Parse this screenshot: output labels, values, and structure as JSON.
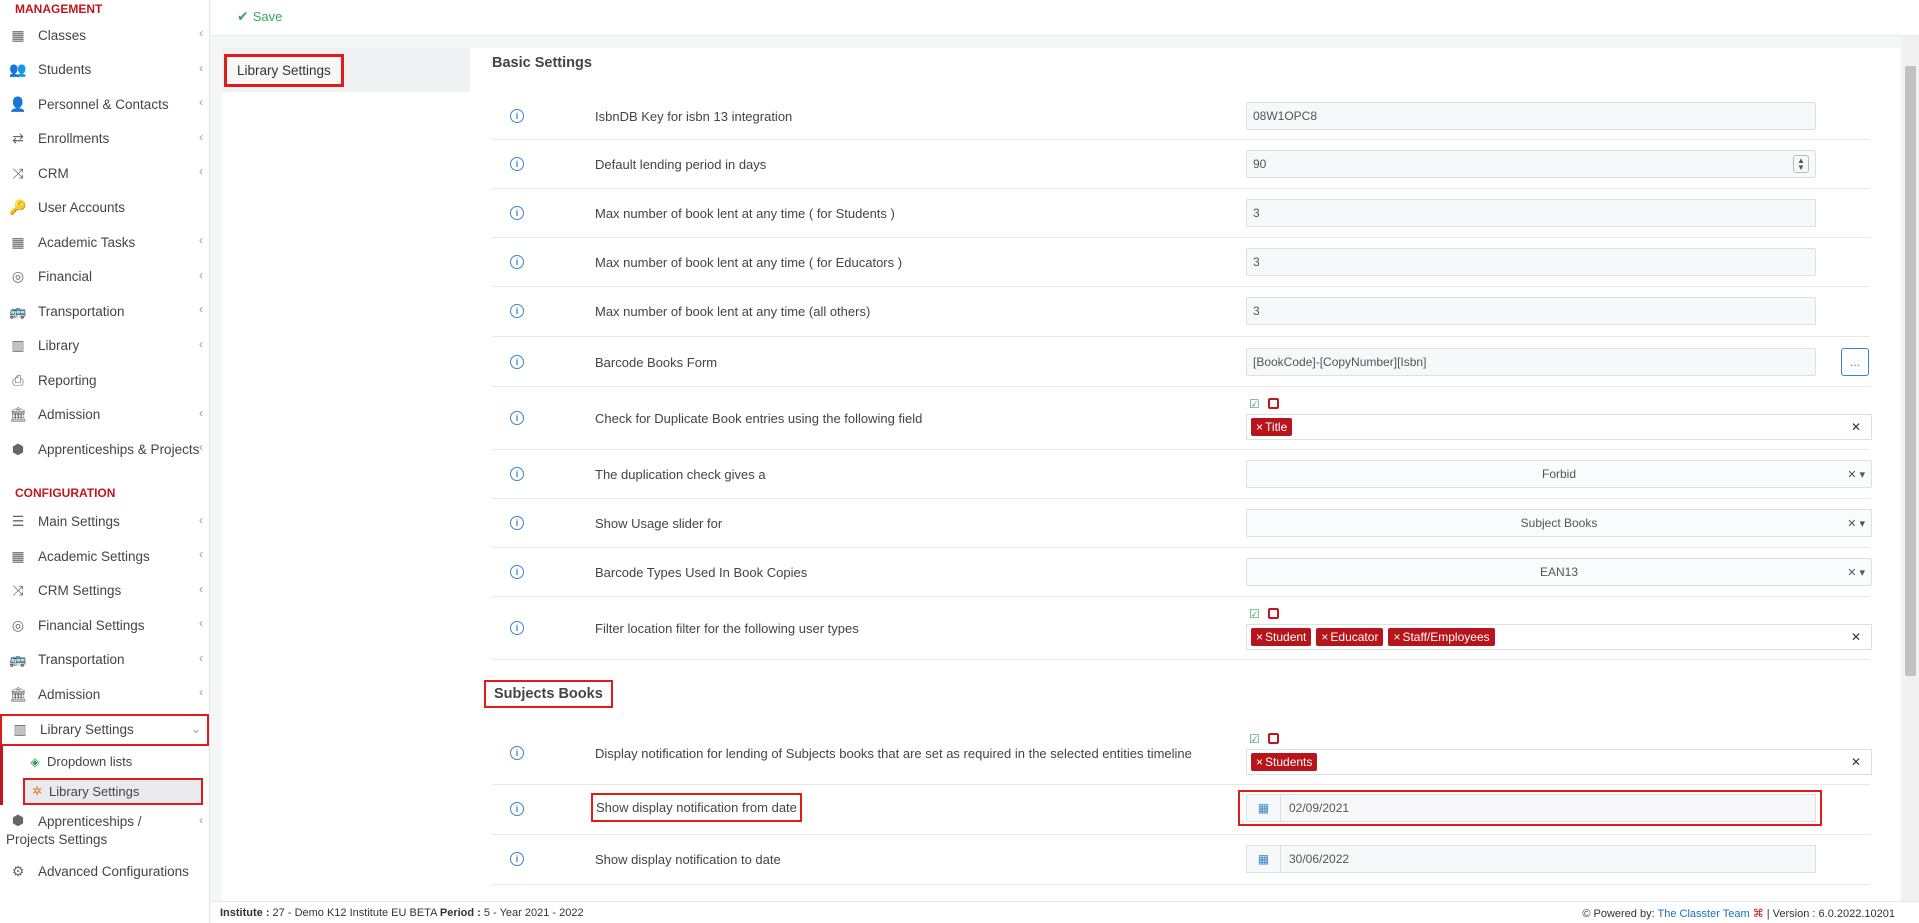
{
  "sidebar": {
    "management_title": "MANAGEMENT",
    "management_items": [
      {
        "label": "Classes",
        "icon": "classes-icon"
      },
      {
        "label": "Students",
        "icon": "students-icon"
      },
      {
        "label": "Personnel & Contacts",
        "icon": "person-icon"
      },
      {
        "label": "Enrollments",
        "icon": "exchange-icon"
      },
      {
        "label": "CRM",
        "icon": "shuffle-icon"
      },
      {
        "label": "User Accounts",
        "icon": "key-icon"
      },
      {
        "label": "Academic Tasks",
        "icon": "tasks-icon"
      },
      {
        "label": "Financial",
        "icon": "coins-icon"
      },
      {
        "label": "Transportation",
        "icon": "bus-icon"
      },
      {
        "label": "Library",
        "icon": "books-icon"
      },
      {
        "label": "Reporting",
        "icon": "printer-icon"
      },
      {
        "label": "Admission",
        "icon": "institution-icon"
      },
      {
        "label": "Apprenticeships & Projects",
        "icon": "cube-icon"
      }
    ],
    "configuration_title": "CONFIGURATION",
    "configuration_items": [
      {
        "label": "Main Settings",
        "icon": "sliders-icon"
      },
      {
        "label": "Academic Settings",
        "icon": "classes-icon"
      },
      {
        "label": "CRM Settings",
        "icon": "shuffle-icon"
      },
      {
        "label": "Financial Settings",
        "icon": "coins-icon"
      },
      {
        "label": "Transportation",
        "icon": "bus-icon"
      },
      {
        "label": "Admission",
        "icon": "institution-icon"
      }
    ],
    "active_item": "Library Settings",
    "sub_items": [
      {
        "label": "Dropdown lists",
        "icon": "layers-icon"
      },
      {
        "label": "Library Settings",
        "icon": "cog-icon"
      }
    ],
    "after_items": [
      {
        "label": "Apprenticeships / Projects Settings",
        "icon": "cube-icon"
      },
      {
        "label": "Advanced Configurations",
        "icon": "cogs-icon"
      }
    ]
  },
  "toolbar": {
    "save_label": "Save"
  },
  "tabs": [
    {
      "label": "Library Settings"
    }
  ],
  "basic": {
    "title": "Basic Settings",
    "isbndb_label": "IsbnDB Key for isbn 13 integration",
    "isbndb_value": "08W1OPC8",
    "lending_label": "Default lending period in days",
    "lending_value": "90",
    "max_students_label": "Max number of book lent at any time ( for Students )",
    "max_students_value": "3",
    "max_educators_label": "Max number of book lent at any time ( for Educators )",
    "max_educators_value": "3",
    "max_others_label": "Max number of book lent at any time (all others)",
    "max_others_value": "3",
    "barcode_form_label": "Barcode Books Form",
    "barcode_form_value": "[BookCode]-[CopyNumber][Isbn]",
    "barcode_form_btn": "...",
    "duplicate_label": "Check for Duplicate Book entries using the following field",
    "duplicate_tags": [
      "Title"
    ],
    "dup_check_label": "The duplication check gives a",
    "dup_check_value": "Forbid",
    "usage_slider_label": "Show Usage slider for",
    "usage_slider_value": "Subject Books",
    "barcode_types_label": "Barcode Types Used In Book Copies",
    "barcode_types_value": "EAN13",
    "location_filter_label": "Filter location filter for the following user types",
    "location_filter_tags": [
      "Student",
      "Educator",
      "Staff/Employees"
    ]
  },
  "subjects": {
    "title": "Subjects Books",
    "display_notif_label": "Display notification for lending of Subjects books that are set as required in the selected entities timeline",
    "display_notif_tags": [
      "Students"
    ],
    "from_date_label": "Show display notification from date",
    "from_date_value": "02/09/2021",
    "to_date_label": "Show display notification to date",
    "to_date_value": "30/06/2022"
  },
  "footer": {
    "institute_label": "Institute :",
    "institute_value": " 27 - Demo K12 Institute EU BETA ",
    "period_label": "Period :",
    "period_value": " 5 - Year 2021 - 2022",
    "powered_label": "Powered by:",
    "powered_link": "The Classter Team",
    "version_text": "| Version : 6.0.2022.10201"
  },
  "colors": {
    "accent_red": "#c0161d",
    "highlight_red": "#e01b1b",
    "info_blue": "#3a86c8",
    "save_green": "#3ba55c",
    "tag_red": "#b8141b"
  }
}
